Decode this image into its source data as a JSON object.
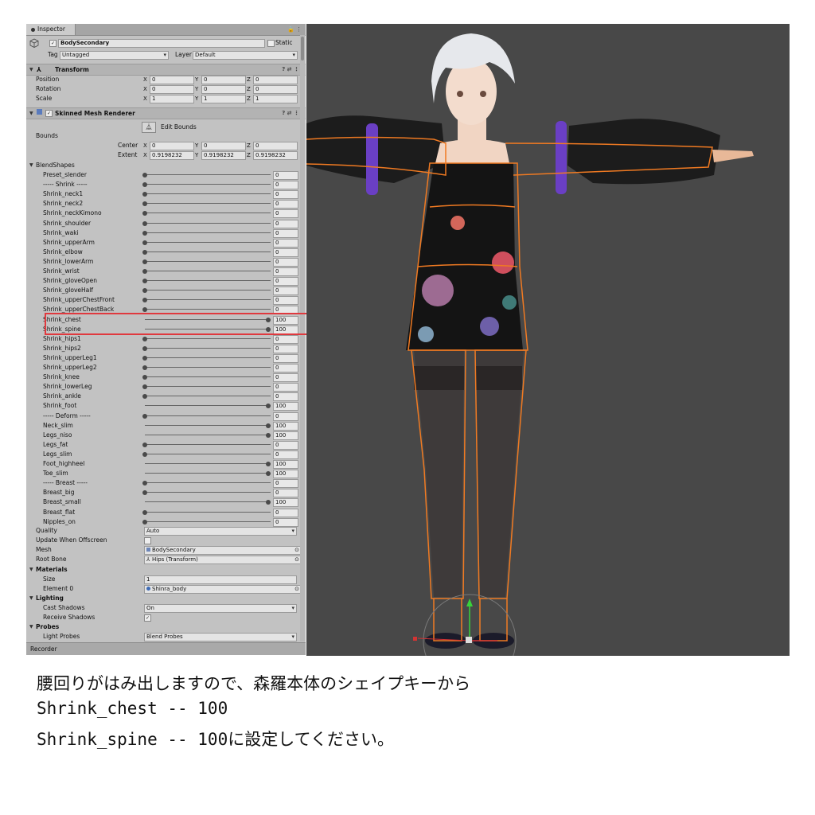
{
  "inspector": {
    "tab_label": "Inspector",
    "object_name": "BodySecondary",
    "static_label": "Static",
    "tag_label": "Tag",
    "tag_value": "Untagged",
    "layer_label": "Layer",
    "layer_value": "Default",
    "transform": {
      "title": "Transform",
      "position_label": "Position",
      "rotation_label": "Rotation",
      "scale_label": "Scale",
      "position": {
        "x": "0",
        "y": "0",
        "z": "0"
      },
      "rotation": {
        "x": "0",
        "y": "0",
        "z": "0"
      },
      "scale": {
        "x": "1",
        "y": "1",
        "z": "1"
      }
    },
    "smr": {
      "title": "Skinned Mesh Renderer",
      "edit_bounds_label": "Edit Bounds",
      "bounds_label": "Bounds",
      "center_label": "Center",
      "extent_label": "Extent",
      "center": {
        "x": "0",
        "y": "0",
        "z": "0"
      },
      "extent": {
        "x": "0.9198232",
        "y": "0.9198232",
        "z": "0.9198232"
      },
      "blendshapes_label": "BlendShapes",
      "quality_label": "Quality",
      "quality_value": "Auto",
      "update_offscreen_label": "Update When Offscreen",
      "mesh_label": "Mesh",
      "mesh_value": "BodySecondary",
      "root_bone_label": "Root Bone",
      "root_bone_value": "Hips (Transform)",
      "materials_label": "Materials",
      "size_label": "Size",
      "size_value": "1",
      "element0_label": "Element 0",
      "element0_value": "Shinra_body",
      "lighting_label": "Lighting",
      "cast_shadows_label": "Cast Shadows",
      "cast_shadows_value": "On",
      "receive_shadows_label": "Receive Shadows",
      "probes_label": "Probes",
      "light_probes_label": "Light Probes",
      "light_probes_value": "Blend Probes"
    },
    "axis": {
      "x": "X",
      "y": "Y",
      "z": "Z"
    },
    "recorder_label": "Recorder"
  },
  "blendshapes": [
    {
      "name": "Preset_slender",
      "value": "0",
      "level": 0
    },
    {
      "name": "----- Shrink -----",
      "value": "0",
      "level": 0
    },
    {
      "name": "Shrink_neck1",
      "value": "0",
      "level": 0
    },
    {
      "name": "Shrink_neck2",
      "value": "0",
      "level": 0
    },
    {
      "name": "Shrink_neckKimono",
      "value": "0",
      "level": 0
    },
    {
      "name": "Shrink_shoulder",
      "value": "0",
      "level": 0
    },
    {
      "name": "Shrink_waki",
      "value": "0",
      "level": 0
    },
    {
      "name": "Shrink_upperArm",
      "value": "0",
      "level": 0
    },
    {
      "name": "Shrink_elbow",
      "value": "0",
      "level": 0
    },
    {
      "name": "Shrink_lowerArm",
      "value": "0",
      "level": 0
    },
    {
      "name": "Shrink_wrist",
      "value": "0",
      "level": 0
    },
    {
      "name": "Shrink_gloveOpen",
      "value": "0",
      "level": 0
    },
    {
      "name": "Shrink_gloveHalf",
      "value": "0",
      "level": 0
    },
    {
      "name": "Shrink_upperChestFront",
      "value": "0",
      "level": 0
    },
    {
      "name": "Shrink_upperChestBack",
      "value": "0",
      "level": 0
    },
    {
      "name": "Shrink_chest",
      "value": "100",
      "level": 1
    },
    {
      "name": "Shrink_spine",
      "value": "100",
      "level": 1
    },
    {
      "name": "Shrink_hips1",
      "value": "0",
      "level": 0
    },
    {
      "name": "Shrink_hips2",
      "value": "0",
      "level": 0
    },
    {
      "name": "Shrink_upperLeg1",
      "value": "0",
      "level": 0
    },
    {
      "name": "Shrink_upperLeg2",
      "value": "0",
      "level": 0
    },
    {
      "name": "Shrink_knee",
      "value": "0",
      "level": 0
    },
    {
      "name": "Shrink_lowerLeg",
      "value": "0",
      "level": 0
    },
    {
      "name": "Shrink_ankle",
      "value": "0",
      "level": 0
    },
    {
      "name": "Shrink_foot",
      "value": "100",
      "level": 1
    },
    {
      "name": "----- Deform -----",
      "value": "0",
      "level": 0
    },
    {
      "name": "Neck_slim",
      "value": "100",
      "level": 1
    },
    {
      "name": "Legs_niso",
      "value": "100",
      "level": 1
    },
    {
      "name": "Legs_fat",
      "value": "0",
      "level": 0
    },
    {
      "name": "Legs_slim",
      "value": "0",
      "level": 0
    },
    {
      "name": "Foot_highheel",
      "value": "100",
      "level": 1
    },
    {
      "name": "Toe_slim",
      "value": "100",
      "level": 1
    },
    {
      "name": "----- Breast -----",
      "value": "0",
      "level": 0
    },
    {
      "name": "Breast_big",
      "value": "0",
      "level": 0
    },
    {
      "name": "Breast_small",
      "value": "100",
      "level": 1
    },
    {
      "name": "Breast_flat",
      "value": "0",
      "level": 0
    },
    {
      "name": "Nipples_on",
      "value": "0",
      "level": 0
    }
  ],
  "caption": {
    "line1": "腰回りがはみ出しますので、森羅本体のシェイプキーから",
    "line2": "Shrink_chest -- 100",
    "line3": "Shrink_spine -- 100に設定してください。"
  },
  "colors": {
    "highlight": "#e0393e",
    "outline": "#f07a22",
    "viewport_bg": "#484848",
    "panel_bg": "#c2c2c2"
  }
}
